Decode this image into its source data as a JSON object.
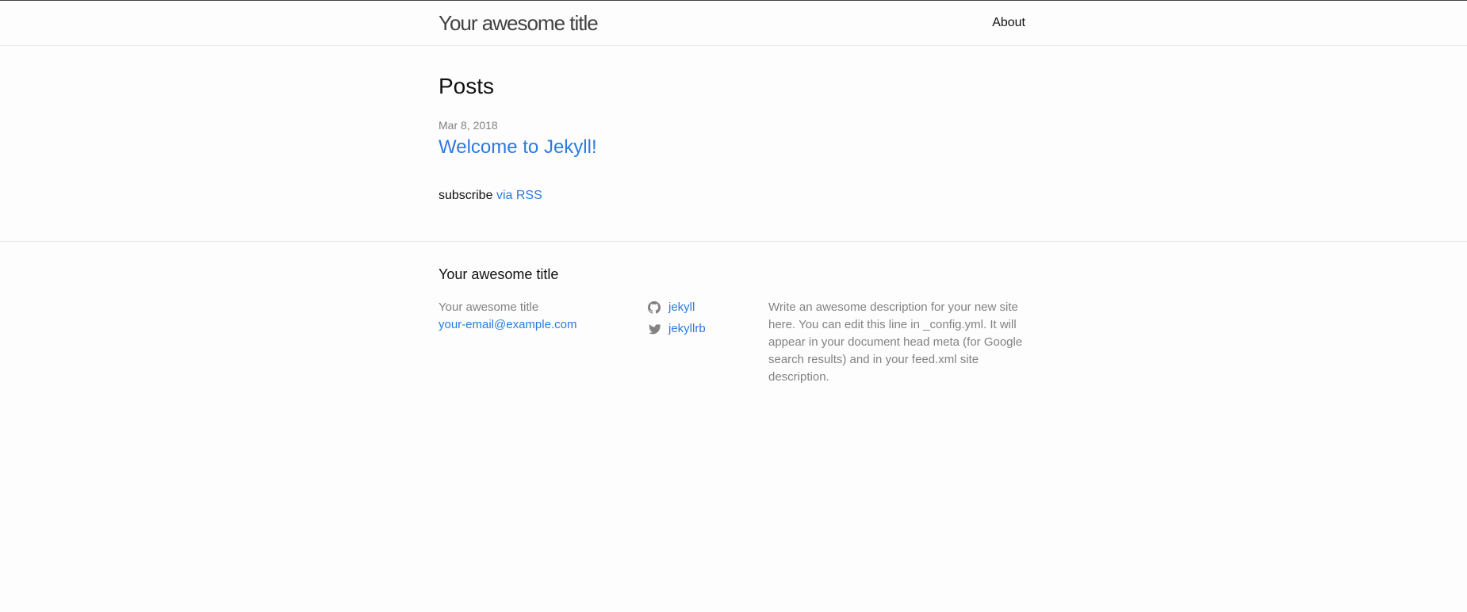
{
  "header": {
    "site_title": "Your awesome title",
    "nav": [
      {
        "label": "About"
      }
    ]
  },
  "main": {
    "heading": "Posts",
    "posts": [
      {
        "date": "Mar 8, 2018",
        "title": "Welcome to Jekyll!"
      }
    ],
    "rss": {
      "prefix": "subscribe",
      "link_label": "via RSS"
    }
  },
  "footer": {
    "heading": "Your awesome title",
    "contact": {
      "name": "Your awesome title",
      "email": "your-email@example.com"
    },
    "social": [
      {
        "icon": "github-icon",
        "label": "jekyll"
      },
      {
        "icon": "twitter-icon",
        "label": "jekyllrb"
      }
    ],
    "description": "Write an awesome description for your new site here. You can edit this line in _config.yml. It will appear in your document head meta (for Google search results) and in your feed.xml site description."
  },
  "colors": {
    "accent": "#2a7ae2",
    "text": "#111111",
    "muted": "#828282",
    "border": "#e8e8e8",
    "background": "#fdfdfd"
  }
}
